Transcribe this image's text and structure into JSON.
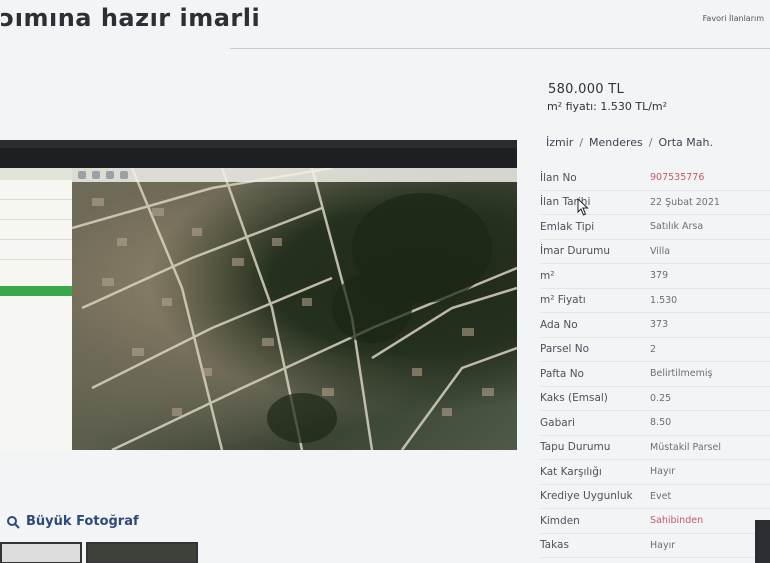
{
  "page": {
    "title": "ɔımına hazır imarli",
    "top_right_link": "Favori İlanlarım"
  },
  "price": {
    "total": "580.000 TL",
    "per_m2": "m² fiyatı: 1.530 TL/m²"
  },
  "breadcrumb": [
    "İzmir",
    "Menderes",
    "Orta Mah."
  ],
  "details": [
    {
      "label": "İlan No",
      "value": "907535776",
      "highlight": true
    },
    {
      "label": "İlan Tarihi",
      "value": "22 Şubat 2021"
    },
    {
      "label": "Emlak Tipi",
      "value": "Satılık Arsa"
    },
    {
      "label": "İmar Durumu",
      "value": "Villa"
    },
    {
      "label": "m²",
      "value": "379"
    },
    {
      "label": "m² Fiyatı",
      "value": "1.530"
    },
    {
      "label": "Ada No",
      "value": "373"
    },
    {
      "label": "Parsel No",
      "value": "2"
    },
    {
      "label": "Pafta No",
      "value": "Belirtilmemiş"
    },
    {
      "label": "Kaks (Emsal)",
      "value": "0.25"
    },
    {
      "label": "Gabari",
      "value": "8.50"
    },
    {
      "label": "Tapu Durumu",
      "value": "Müstakil Parsel"
    },
    {
      "label": "Kat Karşılığı",
      "value": "Hayır"
    },
    {
      "label": "Krediye Uygunluk",
      "value": "Evet"
    },
    {
      "label": "Kimden",
      "value": "Sahibinden",
      "highlight": true
    },
    {
      "label": "Takas",
      "value": "Hayır"
    }
  ],
  "photo_link": "Büyük Fotoğraf",
  "icons": {
    "photo_link": "magnifier-icon",
    "cursor": "mouse-pointer-icon"
  },
  "colors": {
    "accent_red": "#c45a6a",
    "link_blue": "#2d4a7a",
    "map_green": "#39a849"
  }
}
